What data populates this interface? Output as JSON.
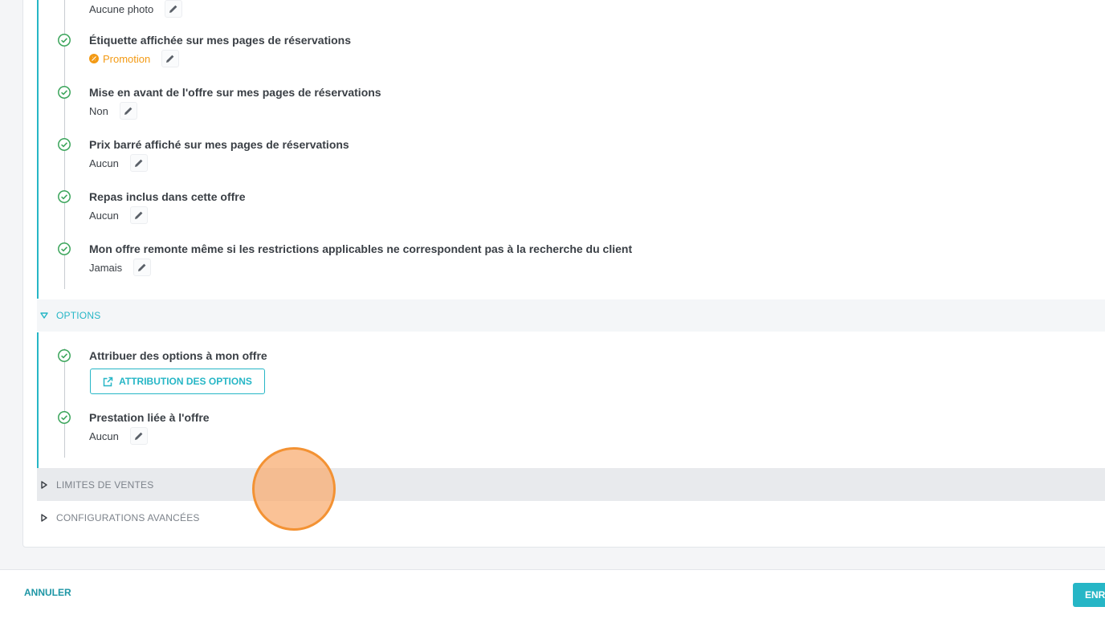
{
  "colors": {
    "accent": "#26b6c6",
    "check_green": "#3aa45a",
    "promo_orange": "#f39a14",
    "cursor_orange": "#f39233"
  },
  "details": {
    "photo_value": "Aucune photo",
    "items": [
      {
        "title": "Étiquette affichée sur mes pages de réservations",
        "value": "Promotion"
      },
      {
        "title": "Mise en avant de l'offre sur mes pages de réservations",
        "value": "Non"
      },
      {
        "title": "Prix barré affiché sur mes pages de réservations",
        "value": "Aucun"
      },
      {
        "title": "Repas inclus dans cette offre",
        "value": "Aucun"
      },
      {
        "title": "Mon offre remonte même si les restrictions applicables ne correspondent pas à la recherche du client",
        "value": "Jamais"
      }
    ]
  },
  "options": {
    "section_label": "OPTIONS",
    "assign_title": "Attribuer des options à mon offre",
    "assign_button": "ATTRIBUTION DES OPTIONS",
    "linked_title": "Prestation liée à l'offre",
    "linked_value": "Aucun"
  },
  "sections": {
    "sales_limits": "LIMITES DE VENTES",
    "advanced": "CONFIGURATIONS AVANCÉES"
  },
  "footer": {
    "cancel": "ANNULER",
    "save": "ENR"
  },
  "icons": {
    "check": "check-circle-icon",
    "edit": "pencil-icon",
    "expand": "triangle-down-icon",
    "collapse": "triangle-right-icon",
    "external": "external-link-icon"
  }
}
